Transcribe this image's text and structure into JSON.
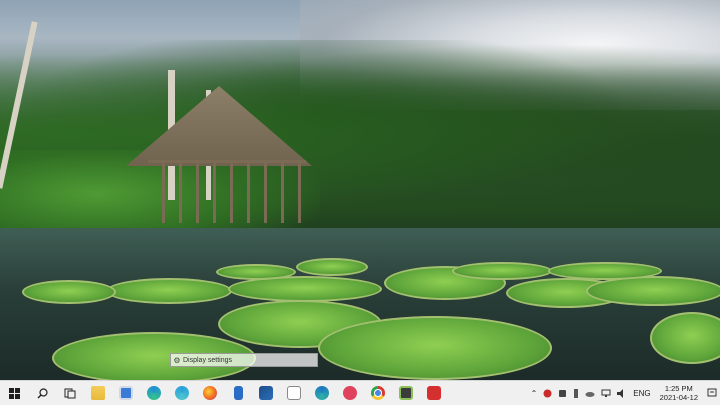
{
  "tooltip": {
    "label": "Display settings",
    "icon": "gear-icon"
  },
  "taskbar": {
    "start_icon": "windows-logo-icon",
    "search_icon": "search-icon",
    "task_view_icon": "task-view-icon",
    "pinned": [
      {
        "name": "file-explorer-icon",
        "color": "#e8b93a"
      },
      {
        "name": "microsoft-store-icon",
        "color": "#3a7bd5"
      },
      {
        "name": "edge-icon",
        "color": "#1f8fd6"
      },
      {
        "name": "edge-beta-icon",
        "color": "#2aa0d8"
      },
      {
        "name": "firefox-icon",
        "color": "#ef6b1f"
      },
      {
        "name": "app-badge-icon",
        "color": "#2b6cc4"
      },
      {
        "name": "window-app-icon",
        "color": "#1e4d8a"
      },
      {
        "name": "document-app-icon",
        "color": "#e9e9e9"
      },
      {
        "name": "edge-dev-icon",
        "color": "#1c78c2"
      },
      {
        "name": "app-red-icon",
        "color": "#e0415c"
      },
      {
        "name": "chrome-icon",
        "color": "#d93a2f"
      },
      {
        "name": "media-app-icon",
        "color": "#3b3b3b"
      },
      {
        "name": "pdf-app-icon",
        "color": "#d62f2f"
      }
    ],
    "tray": {
      "chevron_icon": "chevron-up-icon",
      "icons": [
        "shield-icon",
        "security-icon",
        "usb-icon",
        "cloud-icon",
        "network-icon",
        "volume-icon"
      ],
      "language": "ENG",
      "time": "1:25 PM",
      "date": "2021-04-12",
      "notifications_icon": "notifications-icon"
    }
  }
}
